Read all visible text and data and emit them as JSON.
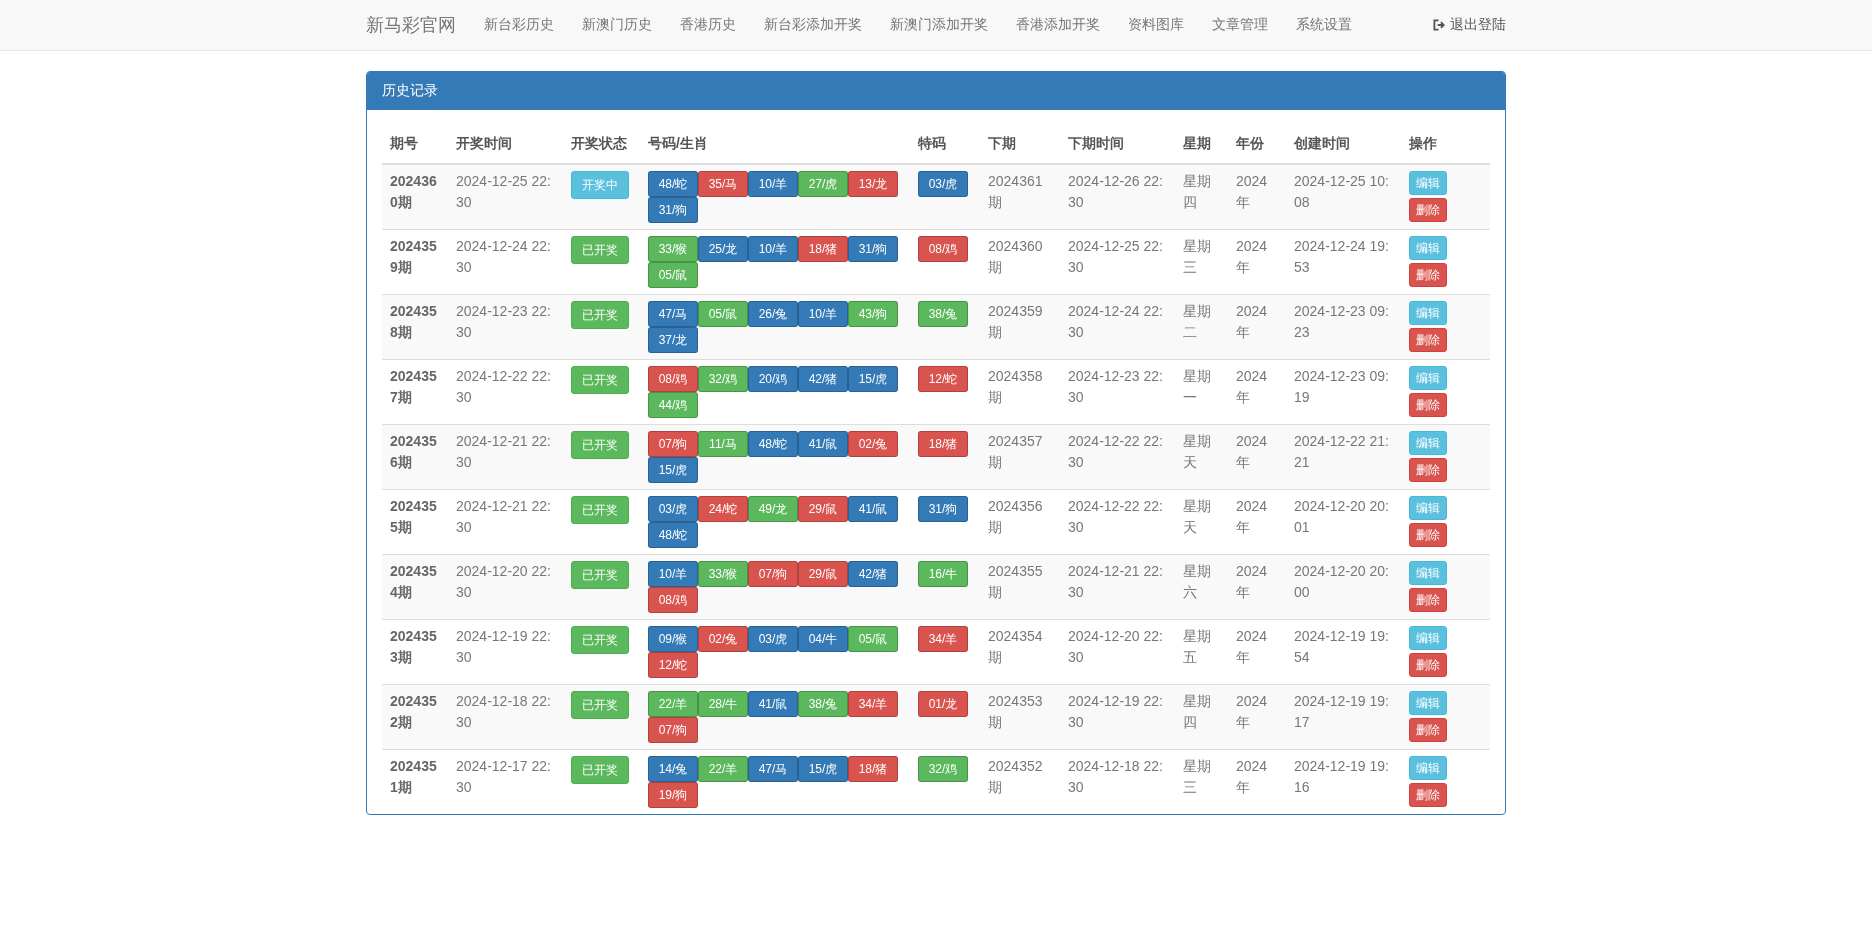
{
  "navbar": {
    "brand": "新马彩官网",
    "items": [
      "新台彩历史",
      "新澳门历史",
      "香港历史",
      "新台彩添加开奖",
      "新澳门添加开奖",
      "香港添加开奖",
      "资料图库",
      "文章管理",
      "系统设置"
    ],
    "logout": "退出登陆"
  },
  "panel": {
    "title": "历史记录"
  },
  "table": {
    "columns": [
      "期号",
      "开奖时间",
      "开奖状态",
      "号码/生肖",
      "特码",
      "下期",
      "下期时间",
      "星期",
      "年份",
      "创建时间",
      "操作"
    ],
    "rows": [
      {
        "issue": "2024360期",
        "draw_time": "2024-12-25 22:30",
        "status": {
          "kind": "live",
          "label": "开奖中"
        },
        "balls": [
          {
            "label": "48/蛇",
            "color": "#337ab7"
          },
          {
            "label": "35/马",
            "color": "#d9534f"
          },
          {
            "label": "10/羊",
            "color": "#337ab7"
          },
          {
            "label": "27/虎",
            "color": "#5cb85c"
          },
          {
            "label": "13/龙",
            "color": "#d9534f"
          },
          {
            "label": "31/狗",
            "color": "#337ab7"
          }
        ],
        "special": {
          "label": "03/虎",
          "color": "#337ab7"
        },
        "next_issue": "2024361期",
        "next_time": "2024-12-26 22:30",
        "weekday": "星期四",
        "year": "2024年",
        "created": "2024-12-25 10:08",
        "edit": "编辑",
        "delete": "删除"
      },
      {
        "issue": "2024359期",
        "draw_time": "2024-12-24 22:30",
        "status": {
          "kind": "done",
          "label": "已开奖"
        },
        "balls": [
          {
            "label": "33/猴",
            "color": "#5cb85c"
          },
          {
            "label": "25/龙",
            "color": "#337ab7"
          },
          {
            "label": "10/羊",
            "color": "#337ab7"
          },
          {
            "label": "18/猪",
            "color": "#d9534f"
          },
          {
            "label": "31/狗",
            "color": "#337ab7"
          },
          {
            "label": "05/鼠",
            "color": "#5cb85c"
          }
        ],
        "special": {
          "label": "08/鸡",
          "color": "#d9534f"
        },
        "next_issue": "2024360期",
        "next_time": "2024-12-25 22:30",
        "weekday": "星期三",
        "year": "2024年",
        "created": "2024-12-24 19:53",
        "edit": "编辑",
        "delete": "删除"
      },
      {
        "issue": "2024358期",
        "draw_time": "2024-12-23 22:30",
        "status": {
          "kind": "done",
          "label": "已开奖"
        },
        "balls": [
          {
            "label": "47/马",
            "color": "#337ab7"
          },
          {
            "label": "05/鼠",
            "color": "#5cb85c"
          },
          {
            "label": "26/兔",
            "color": "#337ab7"
          },
          {
            "label": "10/羊",
            "color": "#337ab7"
          },
          {
            "label": "43/狗",
            "color": "#5cb85c"
          },
          {
            "label": "37/龙",
            "color": "#337ab7"
          }
        ],
        "special": {
          "label": "38/兔",
          "color": "#5cb85c"
        },
        "next_issue": "2024359期",
        "next_time": "2024-12-24 22:30",
        "weekday": "星期二",
        "year": "2024年",
        "created": "2024-12-23 09:23",
        "edit": "编辑",
        "delete": "删除"
      },
      {
        "issue": "2024357期",
        "draw_time": "2024-12-22 22:30",
        "status": {
          "kind": "done",
          "label": "已开奖"
        },
        "balls": [
          {
            "label": "08/鸡",
            "color": "#d9534f"
          },
          {
            "label": "32/鸡",
            "color": "#5cb85c"
          },
          {
            "label": "20/鸡",
            "color": "#337ab7"
          },
          {
            "label": "42/猪",
            "color": "#337ab7"
          },
          {
            "label": "15/虎",
            "color": "#337ab7"
          },
          {
            "label": "44/鸡",
            "color": "#5cb85c"
          }
        ],
        "special": {
          "label": "12/蛇",
          "color": "#d9534f"
        },
        "next_issue": "2024358期",
        "next_time": "2024-12-23 22:30",
        "weekday": "星期一",
        "year": "2024年",
        "created": "2024-12-23 09:19",
        "edit": "编辑",
        "delete": "删除"
      },
      {
        "issue": "2024356期",
        "draw_time": "2024-12-21 22:30",
        "status": {
          "kind": "done",
          "label": "已开奖"
        },
        "balls": [
          {
            "label": "07/狗",
            "color": "#d9534f"
          },
          {
            "label": "11/马",
            "color": "#5cb85c"
          },
          {
            "label": "48/蛇",
            "color": "#337ab7"
          },
          {
            "label": "41/鼠",
            "color": "#337ab7"
          },
          {
            "label": "02/兔",
            "color": "#d9534f"
          },
          {
            "label": "15/虎",
            "color": "#337ab7"
          }
        ],
        "special": {
          "label": "18/猪",
          "color": "#d9534f"
        },
        "next_issue": "2024357期",
        "next_time": "2024-12-22 22:30",
        "weekday": "星期天",
        "year": "2024年",
        "created": "2024-12-22 21:21",
        "edit": "编辑",
        "delete": "删除"
      },
      {
        "issue": "2024355期",
        "draw_time": "2024-12-21 22:30",
        "status": {
          "kind": "done",
          "label": "已开奖"
        },
        "balls": [
          {
            "label": "03/虎",
            "color": "#337ab7"
          },
          {
            "label": "24/蛇",
            "color": "#d9534f"
          },
          {
            "label": "49/龙",
            "color": "#5cb85c"
          },
          {
            "label": "29/鼠",
            "color": "#d9534f"
          },
          {
            "label": "41/鼠",
            "color": "#337ab7"
          },
          {
            "label": "48/蛇",
            "color": "#337ab7"
          }
        ],
        "special": {
          "label": "31/狗",
          "color": "#337ab7"
        },
        "next_issue": "2024356期",
        "next_time": "2024-12-22 22:30",
        "weekday": "星期天",
        "year": "2024年",
        "created": "2024-12-20 20:01",
        "edit": "编辑",
        "delete": "删除"
      },
      {
        "issue": "2024354期",
        "draw_time": "2024-12-20 22:30",
        "status": {
          "kind": "done",
          "label": "已开奖"
        },
        "balls": [
          {
            "label": "10/羊",
            "color": "#337ab7"
          },
          {
            "label": "33/猴",
            "color": "#5cb85c"
          },
          {
            "label": "07/狗",
            "color": "#d9534f"
          },
          {
            "label": "29/鼠",
            "color": "#d9534f"
          },
          {
            "label": "42/猪",
            "color": "#337ab7"
          },
          {
            "label": "08/鸡",
            "color": "#d9534f"
          }
        ],
        "special": {
          "label": "16/牛",
          "color": "#5cb85c"
        },
        "next_issue": "2024355期",
        "next_time": "2024-12-21 22:30",
        "weekday": "星期六",
        "year": "2024年",
        "created": "2024-12-20 20:00",
        "edit": "编辑",
        "delete": "删除"
      },
      {
        "issue": "2024353期",
        "draw_time": "2024-12-19 22:30",
        "status": {
          "kind": "done",
          "label": "已开奖"
        },
        "balls": [
          {
            "label": "09/猴",
            "color": "#337ab7"
          },
          {
            "label": "02/兔",
            "color": "#d9534f"
          },
          {
            "label": "03/虎",
            "color": "#337ab7"
          },
          {
            "label": "04/牛",
            "color": "#337ab7"
          },
          {
            "label": "05/鼠",
            "color": "#5cb85c"
          },
          {
            "label": "12/蛇",
            "color": "#d9534f"
          }
        ],
        "special": {
          "label": "34/羊",
          "color": "#d9534f"
        },
        "next_issue": "2024354期",
        "next_time": "2024-12-20 22:30",
        "weekday": "星期五",
        "year": "2024年",
        "created": "2024-12-19 19:54",
        "edit": "编辑",
        "delete": "删除"
      },
      {
        "issue": "2024352期",
        "draw_time": "2024-12-18 22:30",
        "status": {
          "kind": "done",
          "label": "已开奖"
        },
        "balls": [
          {
            "label": "22/羊",
            "color": "#5cb85c"
          },
          {
            "label": "28/牛",
            "color": "#5cb85c"
          },
          {
            "label": "41/鼠",
            "color": "#337ab7"
          },
          {
            "label": "38/兔",
            "color": "#5cb85c"
          },
          {
            "label": "34/羊",
            "color": "#d9534f"
          },
          {
            "label": "07/狗",
            "color": "#d9534f"
          }
        ],
        "special": {
          "label": "01/龙",
          "color": "#d9534f"
        },
        "next_issue": "2024353期",
        "next_time": "2024-12-19 22:30",
        "weekday": "星期四",
        "year": "2024年",
        "created": "2024-12-19 19:17",
        "edit": "编辑",
        "delete": "删除"
      },
      {
        "issue": "2024351期",
        "draw_time": "2024-12-17 22:30",
        "status": {
          "kind": "done",
          "label": "已开奖"
        },
        "balls": [
          {
            "label": "14/兔",
            "color": "#337ab7"
          },
          {
            "label": "22/羊",
            "color": "#5cb85c"
          },
          {
            "label": "47/马",
            "color": "#337ab7"
          },
          {
            "label": "15/虎",
            "color": "#337ab7"
          },
          {
            "label": "18/猪",
            "color": "#d9534f"
          },
          {
            "label": "19/狗",
            "color": "#d9534f"
          }
        ],
        "special": {
          "label": "32/鸡",
          "color": "#5cb85c"
        },
        "next_issue": "2024352期",
        "next_time": "2024-12-18 22:30",
        "weekday": "星期三",
        "year": "2024年",
        "created": "2024-12-19 19:16",
        "edit": "编辑",
        "delete": "删除"
      }
    ]
  }
}
